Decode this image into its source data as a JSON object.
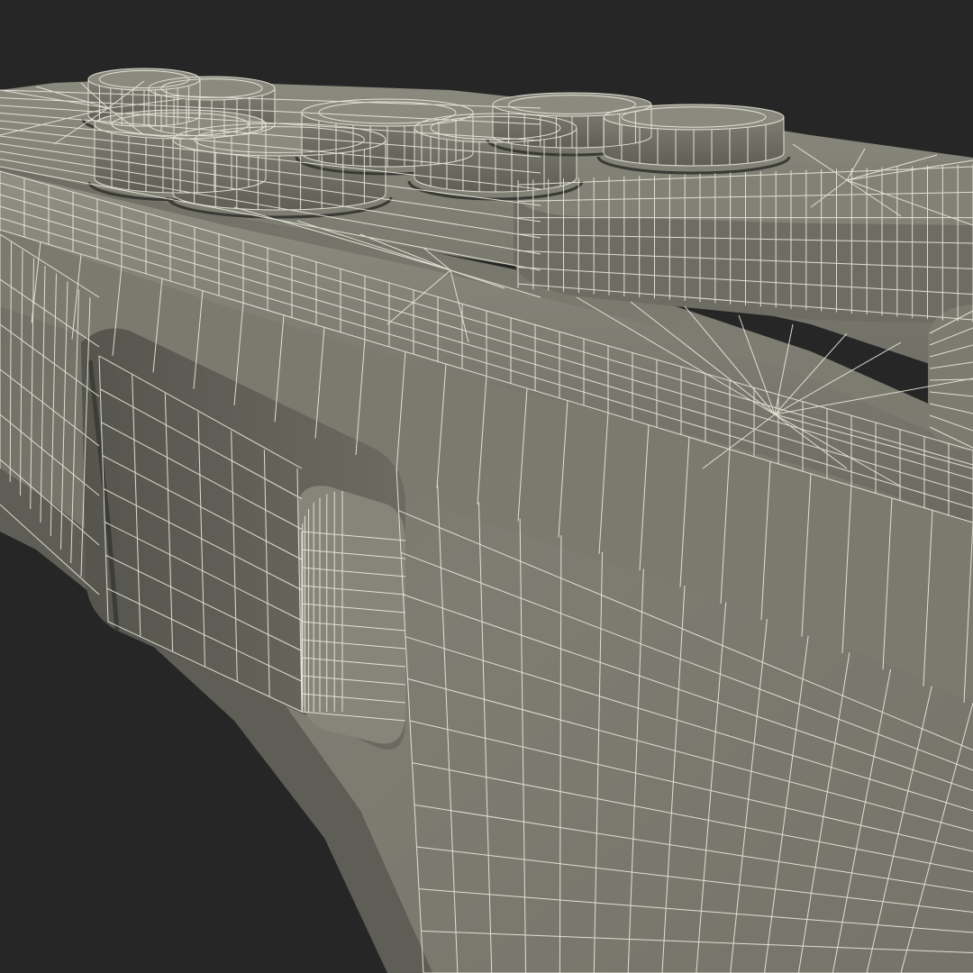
{
  "render": {
    "subject": "wireframe-3d-model",
    "colors": {
      "background": "#262626",
      "surface": "#7b7b70",
      "surface_light": "#8c8c80",
      "surface_dark": "#5c5c54",
      "shadow": "#3e3e38",
      "wire": "#ecebdf"
    }
  }
}
